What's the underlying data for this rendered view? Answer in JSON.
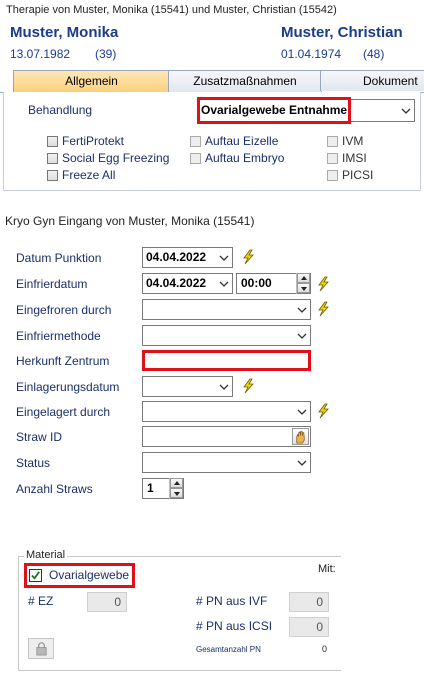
{
  "window_title": "Therapie von Muster, Monika (15541) und Muster, Christian (15542)",
  "patient_left": {
    "name": "Muster, Monika",
    "dob": "13.07.1982",
    "age": "(39)"
  },
  "patient_right": {
    "name": "Muster, Christian",
    "dob": "01.04.1974",
    "age": "(48)"
  },
  "tabs": [
    "Allgemein",
    "Zusatzmaßnahmen",
    "Dokument"
  ],
  "behandlung": {
    "label": "Behandlung",
    "value": "Ovarialgewebe Entnahme",
    "options": [
      [
        "FertiProtekt",
        "Auftau Eizelle",
        "IVM"
      ],
      [
        "Social Egg Freezing",
        "Auftau Embryo",
        "IMSI"
      ],
      [
        "Freeze All",
        "",
        "PICSI"
      ]
    ]
  },
  "section_title": "Kryo Gyn Eingang von Muster, Monika (15541)",
  "form": {
    "datum_punktion": {
      "label": "Datum Punktion",
      "value": "04.04.2022"
    },
    "einfrierdatum": {
      "label": "Einfrierdatum",
      "value": "04.04.2022",
      "time": "00:00"
    },
    "eingefroren_durch": {
      "label": "Eingefroren durch",
      "value": ""
    },
    "einfriermethode": {
      "label": "Einfriermethode",
      "value": ""
    },
    "herkunft_zentrum": {
      "label": "Herkunft Zentrum",
      "value": ""
    },
    "einlagerungsdatum": {
      "label": "Einlagerungsdatum",
      "value": ""
    },
    "eingelagert_durch": {
      "label": "Eingelagert durch",
      "value": ""
    },
    "straw_id": {
      "label": "Straw ID",
      "value": ""
    },
    "status": {
      "label": "Status",
      "value": ""
    },
    "anzahl_straws": {
      "label": "Anzahl Straws",
      "value": "1"
    }
  },
  "material": {
    "legend": "Material",
    "checkbox_label": "Ovarialgewebe",
    "checked": true,
    "mit_label": "Mit:",
    "ez_label": "# EZ",
    "ez_value": "0",
    "pn_ivf_label": "# PN aus IVF",
    "pn_ivf_value": "0",
    "pn_icsi_label": "# PN aus ICSI",
    "pn_icsi_value": "0",
    "gesamt_label": "Gesamtanzahl PN",
    "gesamt_value": "0"
  },
  "colors": {
    "highlight": "#e0101a",
    "label_blue": "#1a2f6b",
    "name_blue": "#1a3c8c",
    "tab_active": "#fbcf7a"
  }
}
